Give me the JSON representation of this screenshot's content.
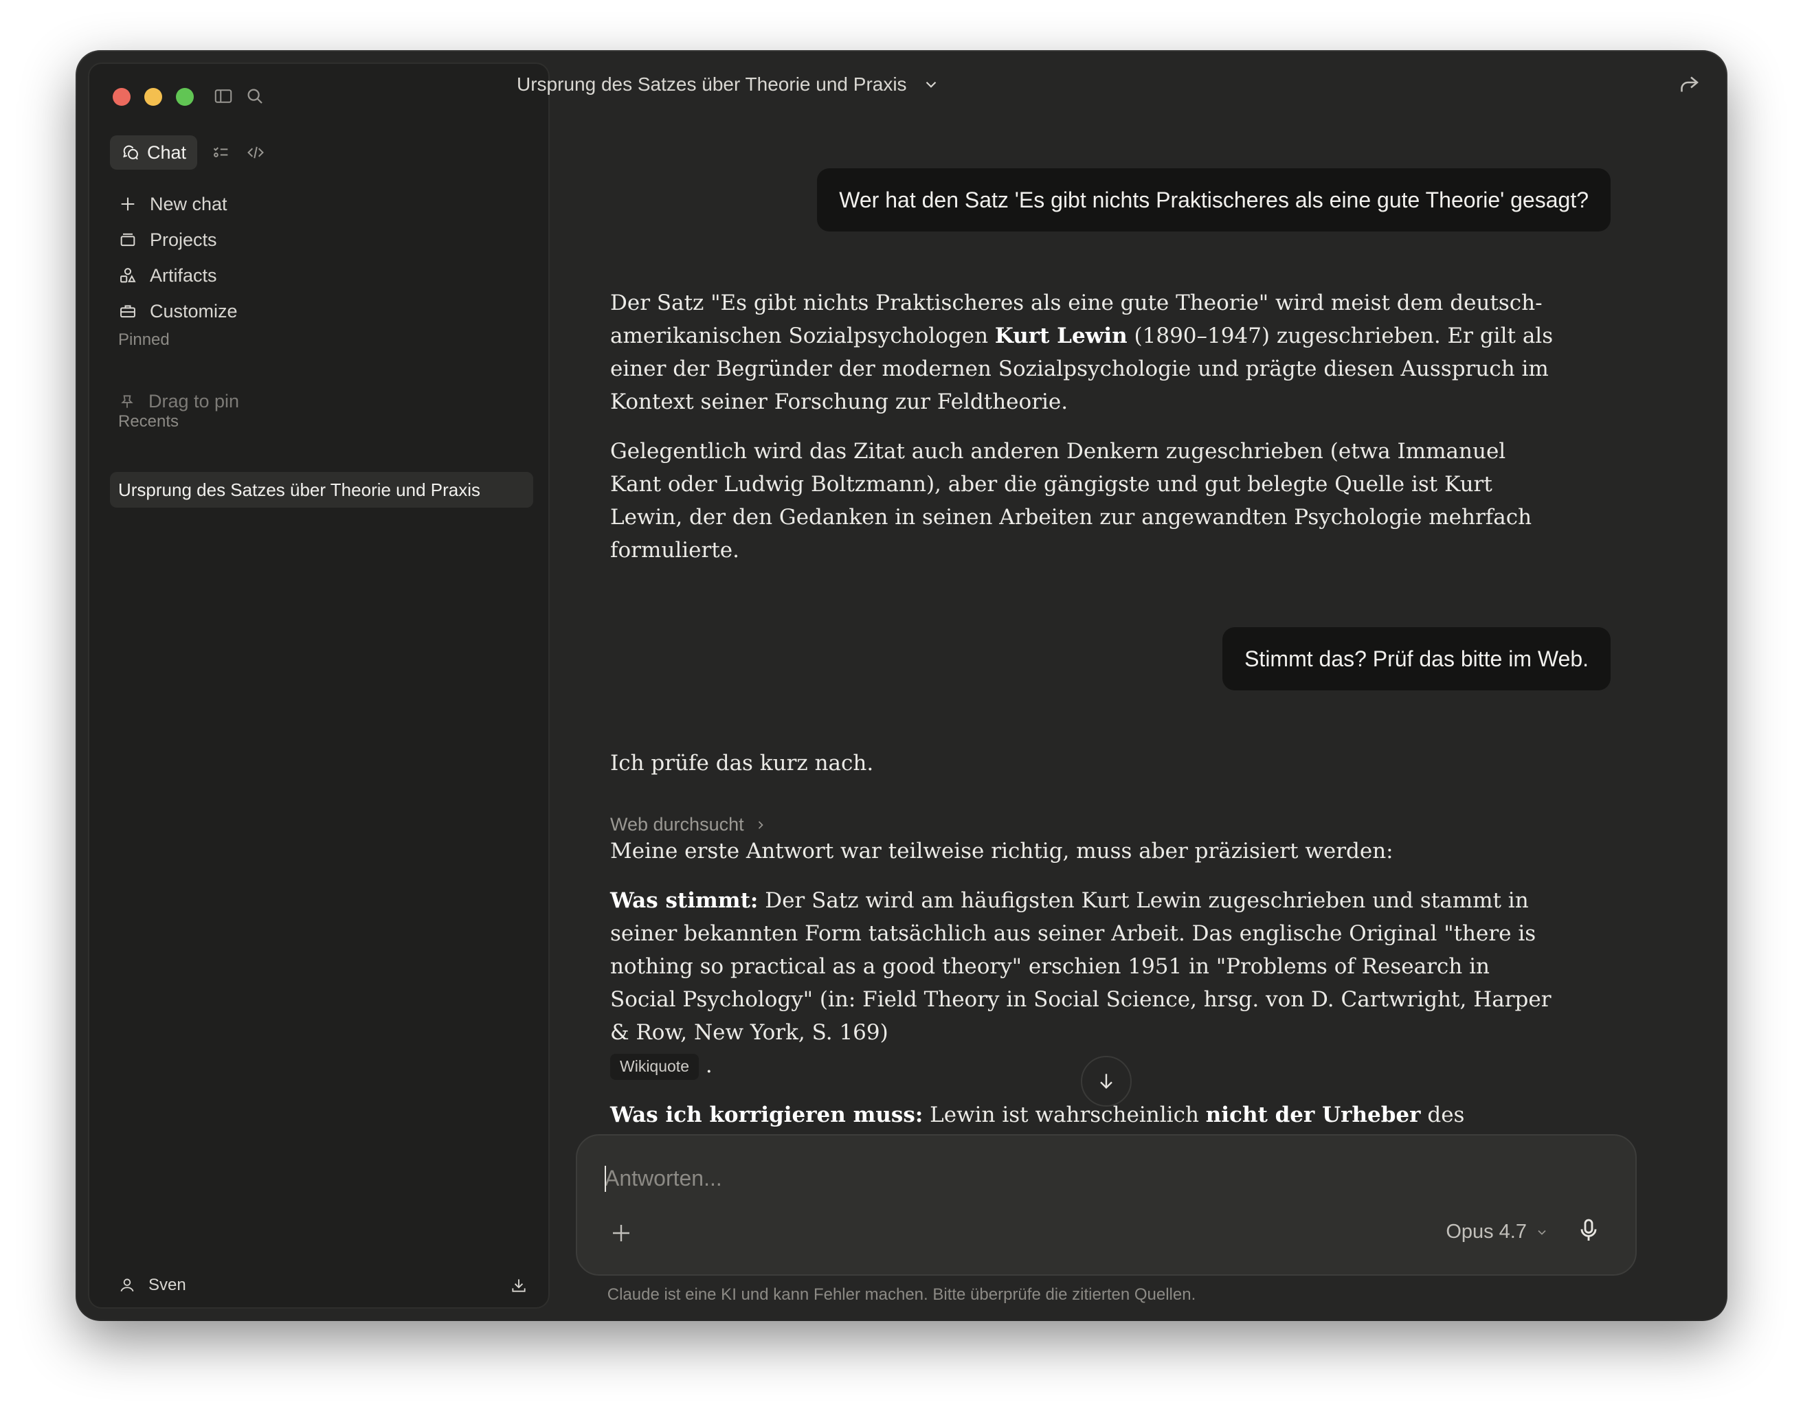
{
  "sidebar": {
    "mode_chat_label": "Chat",
    "nav": [
      {
        "label": "New chat",
        "icon": "plus-icon"
      },
      {
        "label": "Projects",
        "icon": "folder-icon"
      },
      {
        "label": "Artifacts",
        "icon": "artifacts-icon"
      },
      {
        "label": "Customize",
        "icon": "briefcase-icon"
      }
    ],
    "pinned_label": "Pinned",
    "pin_hint": "Drag to pin",
    "recents_label": "Recents",
    "recents": [
      "Ursprung des Satzes über Theorie und Praxis"
    ],
    "user_name": "Sven"
  },
  "header": {
    "title": "Ursprung des Satzes über Theorie und Praxis"
  },
  "messages": {
    "user1": "Wer hat den Satz 'Es gibt nichts Praktischeres als eine gute Theorie' gesagt?",
    "assistant1": {
      "p1_a": "Der Satz \"Es gibt nichts Praktischeres als eine gute Theorie\" wird meist dem deutsch-amerikanischen Sozialpsychologen ",
      "p1_bold": "Kurt Lewin",
      "p1_b": " (1890–1947) zugeschrieben. Er gilt als einer der Begründer der modernen Sozialpsychologie und prägte diesen Ausspruch im Kontext seiner Forschung zur Feldtheorie.",
      "p2": "Gelegentlich wird das Zitat auch anderen Denkern zugeschrieben (etwa Immanuel Kant oder Ludwig Boltzmann), aber die gängigste und gut belegte Quelle ist Kurt Lewin, der den Gedanken in seinen Arbeiten zur angewandten Psychologie mehrfach formulierte."
    },
    "user2": "Stimmt das? Prüf das bitte im Web.",
    "assistant2": {
      "intro": "Ich prüfe das kurz nach.",
      "search_label": "Web durchsucht",
      "p1": "Meine erste Antwort war teilweise richtig, muss aber präzisiert werden:",
      "p2_bold": "Was stimmt:",
      "p2": " Der Satz wird am häufigsten Kurt Lewin zugeschrieben und stammt in seiner bekannten Form tatsächlich aus seiner Arbeit. Das englische Original \"there is nothing so practical as a good theory\" erschien 1951 in \"Problems of Research in Social Psychology\" (in: Field Theory in Social Science, hrsg. von D. Cartwright, Harper & Row, New York, S. 169)",
      "p2_source": "Wikiquote",
      "p2_end": ".",
      "p3_bold": "Was ich korrigieren muss:",
      "p3_a": " Lewin ist wahrscheinlich ",
      "p3_bold2": "nicht der Urheber",
      "p3_b": " des Gedankens. G. Stanley Hall, der erste Präsident der American Psychological Association, hatte das Motto"
    }
  },
  "composer": {
    "placeholder": "Antworten...",
    "model": "Opus 4.7"
  },
  "disclaimer": "Claude ist eine KI und kann Fehler machen. Bitte überprüfe die zitierten Quellen."
}
